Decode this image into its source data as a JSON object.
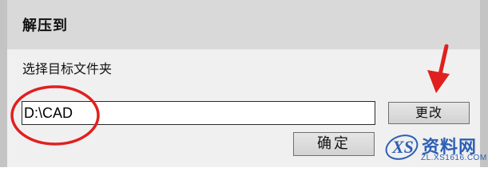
{
  "dialog": {
    "title": "解压到",
    "folder_label": "选择目标文件夹",
    "path_value": "D:\\CAD",
    "change_label": "更改",
    "ok_label": "确定"
  },
  "watermark": {
    "brand": "资料网",
    "url": "ZL.XS1616.COM",
    "logo_text": "XS"
  },
  "colors": {
    "annotation_red": "#e0201e",
    "watermark_blue": "#2d5fb4"
  }
}
